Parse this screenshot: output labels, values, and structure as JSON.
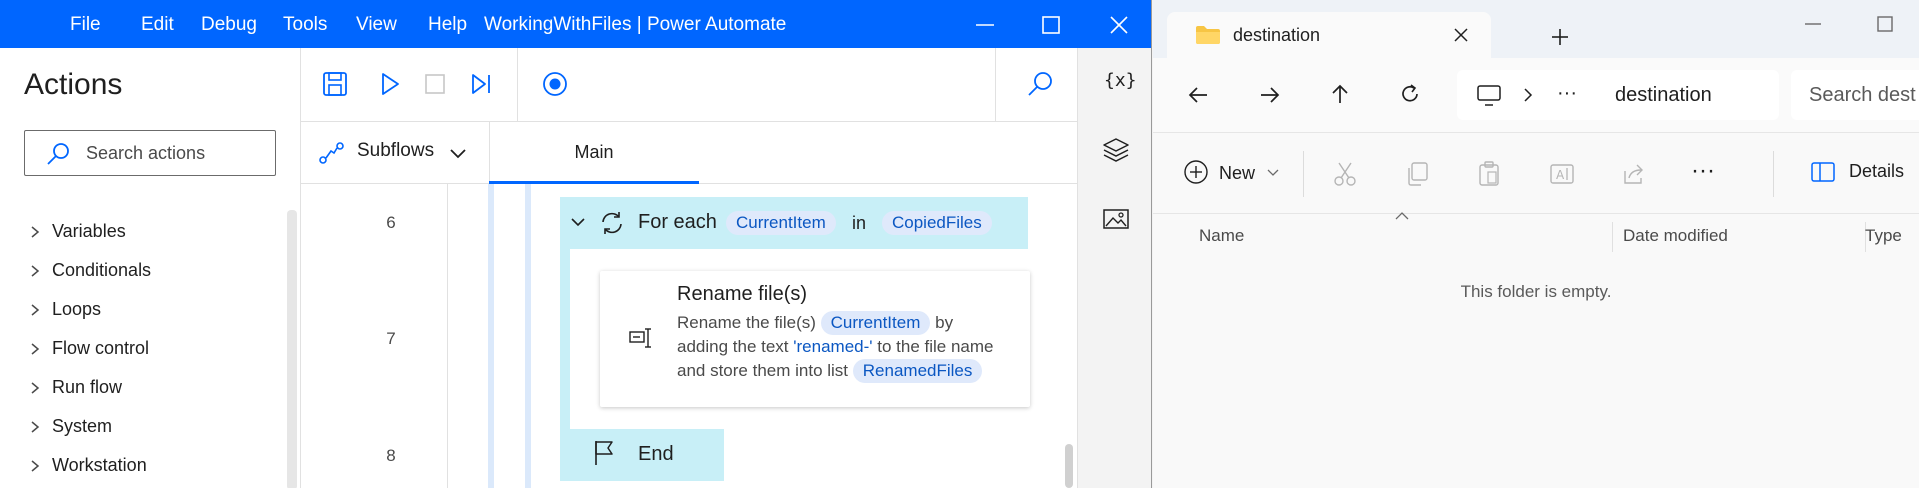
{
  "pa": {
    "menu": [
      "File",
      "Edit",
      "Debug",
      "Tools",
      "View",
      "Help"
    ],
    "title": "WorkingWithFiles | Power Automate",
    "actions_title": "Actions",
    "search_placeholder": "Search actions",
    "categories": [
      "Variables",
      "Conditionals",
      "Loops",
      "Flow control",
      "Run flow",
      "System",
      "Workstation"
    ],
    "subflows_label": "Subflows",
    "tab_main": "Main",
    "vars_icon": "{x}",
    "steps": {
      "line6": "6",
      "line7": "7",
      "line8": "8",
      "foreach_label": "For each",
      "foreach_item": "CurrentItem",
      "foreach_in": "in",
      "foreach_list": "CopiedFiles",
      "rename_title": "Rename file(s)",
      "rename_desc_1": "Rename the file(s)",
      "rename_token_1": "CurrentItem",
      "rename_desc_2": "by adding the text",
      "rename_text": "'renamed-'",
      "rename_desc_3": "to the file name and store them into list",
      "rename_token_2": "RenamedFiles",
      "end_label": "End"
    },
    "colors": {
      "titlebar": "#0066ff",
      "loop_block": "#c8eff7",
      "token_bg": "#dfe9fb",
      "token_fg": "#0b57c2"
    }
  },
  "fe": {
    "tab_title": "destination",
    "breadcrumb_more": "···",
    "breadcrumb_current": "destination",
    "search_placeholder": "Search dest",
    "new_label": "New",
    "more_label": "···",
    "details_label": "Details",
    "columns": {
      "name": "Name",
      "date": "Date modified",
      "type": "Type"
    },
    "empty_message": "This folder is empty."
  }
}
